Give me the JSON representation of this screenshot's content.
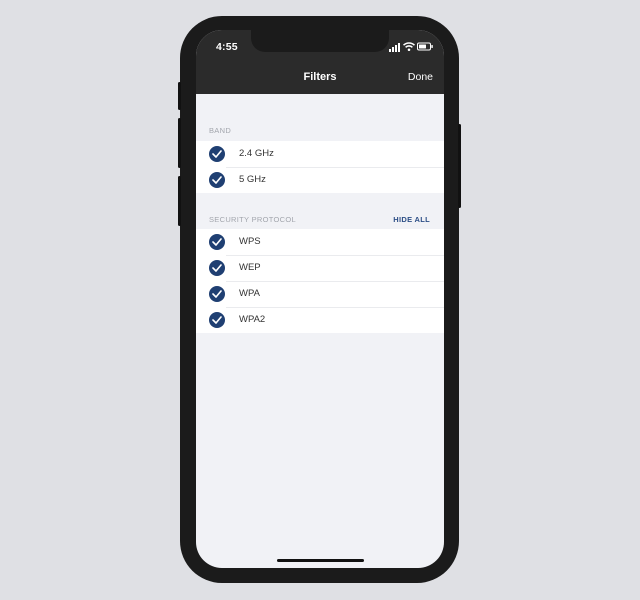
{
  "status_bar": {
    "time": "4:55"
  },
  "nav": {
    "title": "Filters",
    "done_label": "Done"
  },
  "band": {
    "label": "BAND",
    "options": [
      {
        "label": "2.4 GHz",
        "checked": true
      },
      {
        "label": "5 GHz",
        "checked": true
      }
    ]
  },
  "security": {
    "label": "SECURITY PROTOCOL",
    "action_label": "HIDE ALL",
    "options": [
      {
        "label": "WPS",
        "checked": true
      },
      {
        "label": "WEP",
        "checked": true
      },
      {
        "label": "WPA",
        "checked": true
      },
      {
        "label": "WPA2",
        "checked": true
      }
    ]
  },
  "colors": {
    "accent": "#1f3f72",
    "link": "#2d4f86",
    "header": "#2b2b2b",
    "background": "#f1f2f6"
  },
  "icons": [
    "signal-icon",
    "wifi-icon",
    "battery-icon",
    "checkmark-icon"
  ]
}
